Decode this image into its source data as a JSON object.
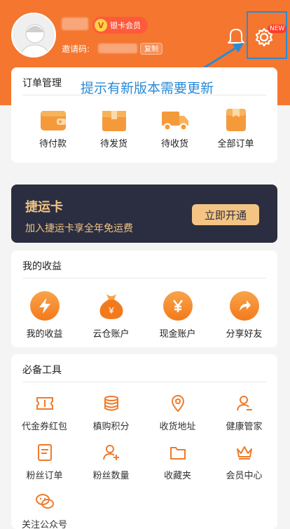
{
  "colors": {
    "brand_orange": "#f4762f",
    "annotation_blue": "#2a8ad6",
    "card_dark": "#2b2e40",
    "gold": "#f3c484"
  },
  "header": {
    "vip_badge_letter": "V",
    "vip_badge_label": "银卡会员",
    "invite_label": "邀请码:",
    "copy_label": "复制",
    "settings_new_tag": "NEW",
    "annotation_text": "提示有新版本需要更新"
  },
  "orders": {
    "title": "订单管理",
    "items": [
      {
        "label": "待付款",
        "icon": "wallet-icon"
      },
      {
        "label": "待发货",
        "icon": "package-icon"
      },
      {
        "label": "待收货",
        "icon": "truck-icon"
      },
      {
        "label": "全部订单",
        "icon": "orders-icon"
      }
    ]
  },
  "jieyun_card": {
    "title": "捷运卡",
    "subtitle": "加入捷运卡享全年免运费",
    "button_label": "立即开通"
  },
  "earnings": {
    "title": "我的收益",
    "items": [
      {
        "label": "我的收益",
        "icon": "lightning-icon"
      },
      {
        "label": "云仓账户",
        "icon": "money-bag-icon"
      },
      {
        "label": "现金账户",
        "icon": "yen-coin-icon"
      },
      {
        "label": "分享好友",
        "icon": "share-icon"
      }
    ]
  },
  "tools": {
    "title": "必备工具",
    "items": [
      {
        "label": "代金券红包",
        "icon": "coupon-icon"
      },
      {
        "label": "槙购积分",
        "icon": "coin-stack-icon"
      },
      {
        "label": "收货地址",
        "icon": "location-pin-icon"
      },
      {
        "label": "健康管家",
        "icon": "health-user-icon"
      },
      {
        "label": "粉丝订单",
        "icon": "document-icon"
      },
      {
        "label": "粉丝数量",
        "icon": "user-add-icon"
      },
      {
        "label": "收藏夹",
        "icon": "folder-icon"
      },
      {
        "label": "会员中心",
        "icon": "crown-icon"
      },
      {
        "label": "关注公众号",
        "icon": "wechat-icon"
      }
    ]
  }
}
